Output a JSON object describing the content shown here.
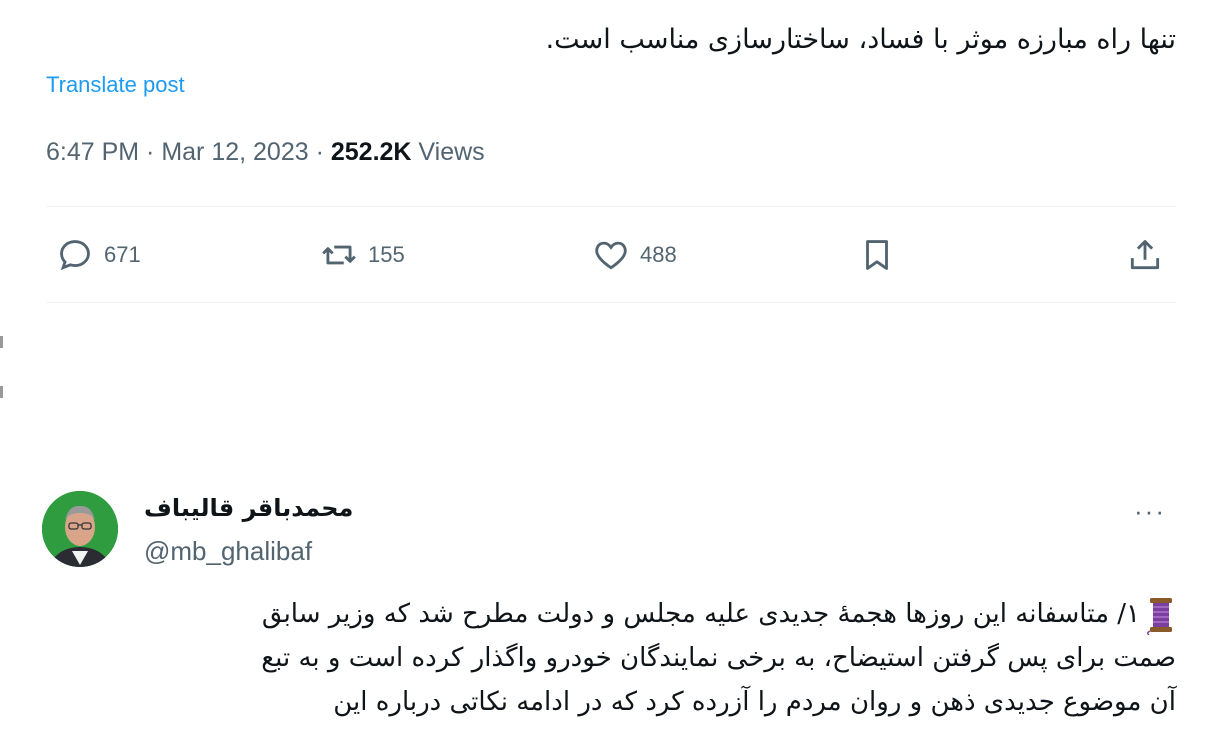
{
  "top_tweet": {
    "text": "تنها راه مبارزه موثر با فساد، ساختارسازی مناسب است.",
    "translate_label": "Translate post",
    "time": "6:47 PM · Mar 12, 2023 · ",
    "views_count": "252.2K",
    "views_label": " Views",
    "actions": {
      "replies": "671",
      "reposts": "155",
      "likes": "488"
    }
  },
  "second_tweet": {
    "author_name": "محمدباقر قالیباف",
    "handle": "@mb_ghalibaf",
    "more_label": "···",
    "lines": [
      "۱/ متاسفانه این روزها هجمهٔ جدیدی علیه مجلس و دولت مطرح شد که وزیر سابق",
      "صمت برای پس گرفتن استیضاح، به برخی نمایندگان خودرو واگذار کرده است و به تبع",
      "آن موضوع جدیدی ذهن و روان مردم را آزرده کرد که در ادامه  نکاتی درباره این"
    ]
  },
  "icons": [
    "reply-icon",
    "repost-icon",
    "like-icon",
    "bookmark-icon",
    "share-icon",
    "thread-emoji-icon",
    "more-icon"
  ]
}
